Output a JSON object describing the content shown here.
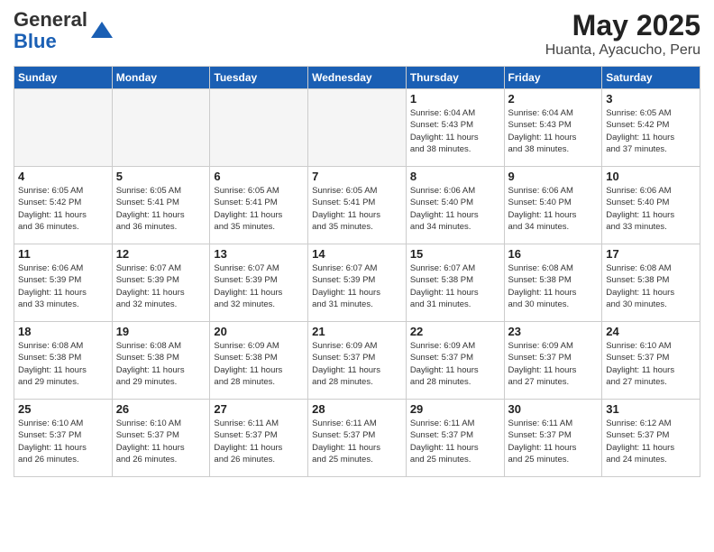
{
  "header": {
    "logo_general": "General",
    "logo_blue": "Blue",
    "title": "May 2025",
    "subtitle": "Huanta, Ayacucho, Peru"
  },
  "weekdays": [
    "Sunday",
    "Monday",
    "Tuesday",
    "Wednesday",
    "Thursday",
    "Friday",
    "Saturday"
  ],
  "weeks": [
    [
      {
        "day": "",
        "info": ""
      },
      {
        "day": "",
        "info": ""
      },
      {
        "day": "",
        "info": ""
      },
      {
        "day": "",
        "info": ""
      },
      {
        "day": "1",
        "info": "Sunrise: 6:04 AM\nSunset: 5:43 PM\nDaylight: 11 hours\nand 38 minutes."
      },
      {
        "day": "2",
        "info": "Sunrise: 6:04 AM\nSunset: 5:43 PM\nDaylight: 11 hours\nand 38 minutes."
      },
      {
        "day": "3",
        "info": "Sunrise: 6:05 AM\nSunset: 5:42 PM\nDaylight: 11 hours\nand 37 minutes."
      }
    ],
    [
      {
        "day": "4",
        "info": "Sunrise: 6:05 AM\nSunset: 5:42 PM\nDaylight: 11 hours\nand 36 minutes."
      },
      {
        "day": "5",
        "info": "Sunrise: 6:05 AM\nSunset: 5:41 PM\nDaylight: 11 hours\nand 36 minutes."
      },
      {
        "day": "6",
        "info": "Sunrise: 6:05 AM\nSunset: 5:41 PM\nDaylight: 11 hours\nand 35 minutes."
      },
      {
        "day": "7",
        "info": "Sunrise: 6:05 AM\nSunset: 5:41 PM\nDaylight: 11 hours\nand 35 minutes."
      },
      {
        "day": "8",
        "info": "Sunrise: 6:06 AM\nSunset: 5:40 PM\nDaylight: 11 hours\nand 34 minutes."
      },
      {
        "day": "9",
        "info": "Sunrise: 6:06 AM\nSunset: 5:40 PM\nDaylight: 11 hours\nand 34 minutes."
      },
      {
        "day": "10",
        "info": "Sunrise: 6:06 AM\nSunset: 5:40 PM\nDaylight: 11 hours\nand 33 minutes."
      }
    ],
    [
      {
        "day": "11",
        "info": "Sunrise: 6:06 AM\nSunset: 5:39 PM\nDaylight: 11 hours\nand 33 minutes."
      },
      {
        "day": "12",
        "info": "Sunrise: 6:07 AM\nSunset: 5:39 PM\nDaylight: 11 hours\nand 32 minutes."
      },
      {
        "day": "13",
        "info": "Sunrise: 6:07 AM\nSunset: 5:39 PM\nDaylight: 11 hours\nand 32 minutes."
      },
      {
        "day": "14",
        "info": "Sunrise: 6:07 AM\nSunset: 5:39 PM\nDaylight: 11 hours\nand 31 minutes."
      },
      {
        "day": "15",
        "info": "Sunrise: 6:07 AM\nSunset: 5:38 PM\nDaylight: 11 hours\nand 31 minutes."
      },
      {
        "day": "16",
        "info": "Sunrise: 6:08 AM\nSunset: 5:38 PM\nDaylight: 11 hours\nand 30 minutes."
      },
      {
        "day": "17",
        "info": "Sunrise: 6:08 AM\nSunset: 5:38 PM\nDaylight: 11 hours\nand 30 minutes."
      }
    ],
    [
      {
        "day": "18",
        "info": "Sunrise: 6:08 AM\nSunset: 5:38 PM\nDaylight: 11 hours\nand 29 minutes."
      },
      {
        "day": "19",
        "info": "Sunrise: 6:08 AM\nSunset: 5:38 PM\nDaylight: 11 hours\nand 29 minutes."
      },
      {
        "day": "20",
        "info": "Sunrise: 6:09 AM\nSunset: 5:38 PM\nDaylight: 11 hours\nand 28 minutes."
      },
      {
        "day": "21",
        "info": "Sunrise: 6:09 AM\nSunset: 5:37 PM\nDaylight: 11 hours\nand 28 minutes."
      },
      {
        "day": "22",
        "info": "Sunrise: 6:09 AM\nSunset: 5:37 PM\nDaylight: 11 hours\nand 28 minutes."
      },
      {
        "day": "23",
        "info": "Sunrise: 6:09 AM\nSunset: 5:37 PM\nDaylight: 11 hours\nand 27 minutes."
      },
      {
        "day": "24",
        "info": "Sunrise: 6:10 AM\nSunset: 5:37 PM\nDaylight: 11 hours\nand 27 minutes."
      }
    ],
    [
      {
        "day": "25",
        "info": "Sunrise: 6:10 AM\nSunset: 5:37 PM\nDaylight: 11 hours\nand 26 minutes."
      },
      {
        "day": "26",
        "info": "Sunrise: 6:10 AM\nSunset: 5:37 PM\nDaylight: 11 hours\nand 26 minutes."
      },
      {
        "day": "27",
        "info": "Sunrise: 6:11 AM\nSunset: 5:37 PM\nDaylight: 11 hours\nand 26 minutes."
      },
      {
        "day": "28",
        "info": "Sunrise: 6:11 AM\nSunset: 5:37 PM\nDaylight: 11 hours\nand 25 minutes."
      },
      {
        "day": "29",
        "info": "Sunrise: 6:11 AM\nSunset: 5:37 PM\nDaylight: 11 hours\nand 25 minutes."
      },
      {
        "day": "30",
        "info": "Sunrise: 6:11 AM\nSunset: 5:37 PM\nDaylight: 11 hours\nand 25 minutes."
      },
      {
        "day": "31",
        "info": "Sunrise: 6:12 AM\nSunset: 5:37 PM\nDaylight: 11 hours\nand 24 minutes."
      }
    ]
  ]
}
